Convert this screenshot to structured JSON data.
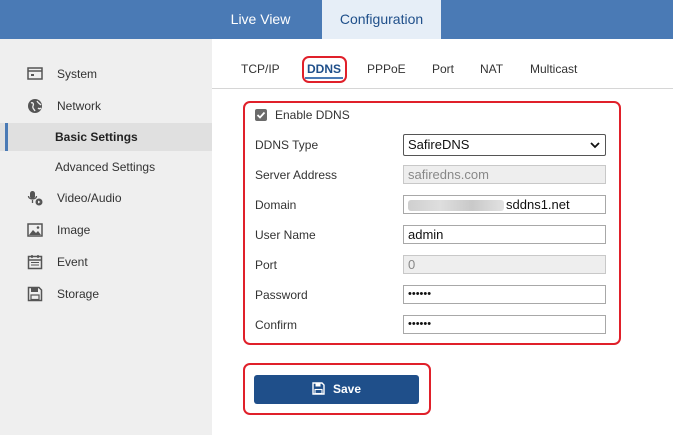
{
  "topnav": {
    "live_view": "Live View",
    "configuration": "Configuration"
  },
  "sidebar": {
    "items": [
      {
        "label": "System",
        "icon": "monitor-icon"
      },
      {
        "label": "Network",
        "icon": "globe-icon"
      },
      {
        "label": "Basic Settings",
        "icon": "",
        "active": true
      },
      {
        "label": "Advanced Settings",
        "icon": ""
      },
      {
        "label": "Video/Audio",
        "icon": "microphone-camera-icon"
      },
      {
        "label": "Image",
        "icon": "image-icon"
      },
      {
        "label": "Event",
        "icon": "calendar-icon"
      },
      {
        "label": "Storage",
        "icon": "floppy-disk-icon"
      }
    ]
  },
  "subtabs": [
    "TCP/IP",
    "DDNS",
    "PPPoE",
    "Port",
    "NAT",
    "Multicast"
  ],
  "form": {
    "enable_label": "Enable DDNS",
    "enable_checked": true,
    "ddns_type_label": "DDNS Type",
    "ddns_type_value": "SafireDNS",
    "server_address_label": "Server Address",
    "server_address_value": "safiredns.com",
    "domain_label": "Domain",
    "domain_suffix": "sddns1.net",
    "user_name_label": "User Name",
    "user_name_value": "admin",
    "port_label": "Port",
    "port_value": "0",
    "password_label": "Password",
    "password_value": "••••••",
    "confirm_label": "Confirm",
    "confirm_value": "••••••"
  },
  "save_label": "Save",
  "colors": {
    "topbar": "#4a7ab5",
    "accent": "#1f4f8a",
    "highlight": "#e0202a"
  }
}
